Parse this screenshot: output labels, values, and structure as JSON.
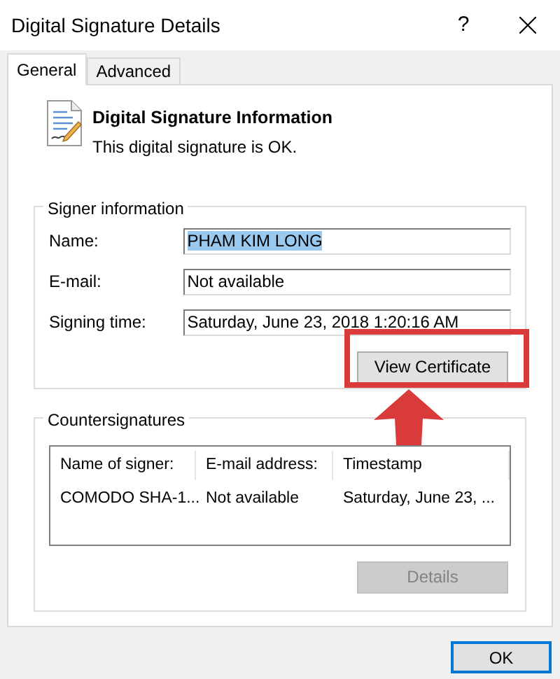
{
  "window": {
    "title": "Digital Signature Details",
    "help": "?"
  },
  "tabs": [
    {
      "label": "General",
      "selected": true
    },
    {
      "label": "Advanced",
      "selected": false
    }
  ],
  "header": {
    "title": "Digital Signature Information",
    "message": "This digital signature is OK."
  },
  "signer_information": {
    "title": "Signer information",
    "fields": [
      {
        "label": "Name:",
        "value": "PHAM KIM LONG",
        "text_selected": true
      },
      {
        "label": "E-mail:",
        "value": "Not available",
        "text_selected": false
      },
      {
        "label": "Signing time:",
        "value": "Saturday, June 23, 2018 1:20:16 AM",
        "text_selected": false
      }
    ],
    "button": {
      "label": "View Certificate",
      "disabled": false
    }
  },
  "countersignatures": {
    "title": "Countersignatures",
    "columns": [
      "Name of signer:",
      "E-mail address:",
      "Timestamp"
    ],
    "rows": [
      [
        "COMODO SHA-1...",
        "Not available",
        "Saturday, June 23, ..."
      ]
    ],
    "button": {
      "label": "Details",
      "disabled": true
    }
  },
  "buttons": [
    {
      "label": "OK",
      "default": true
    }
  ]
}
